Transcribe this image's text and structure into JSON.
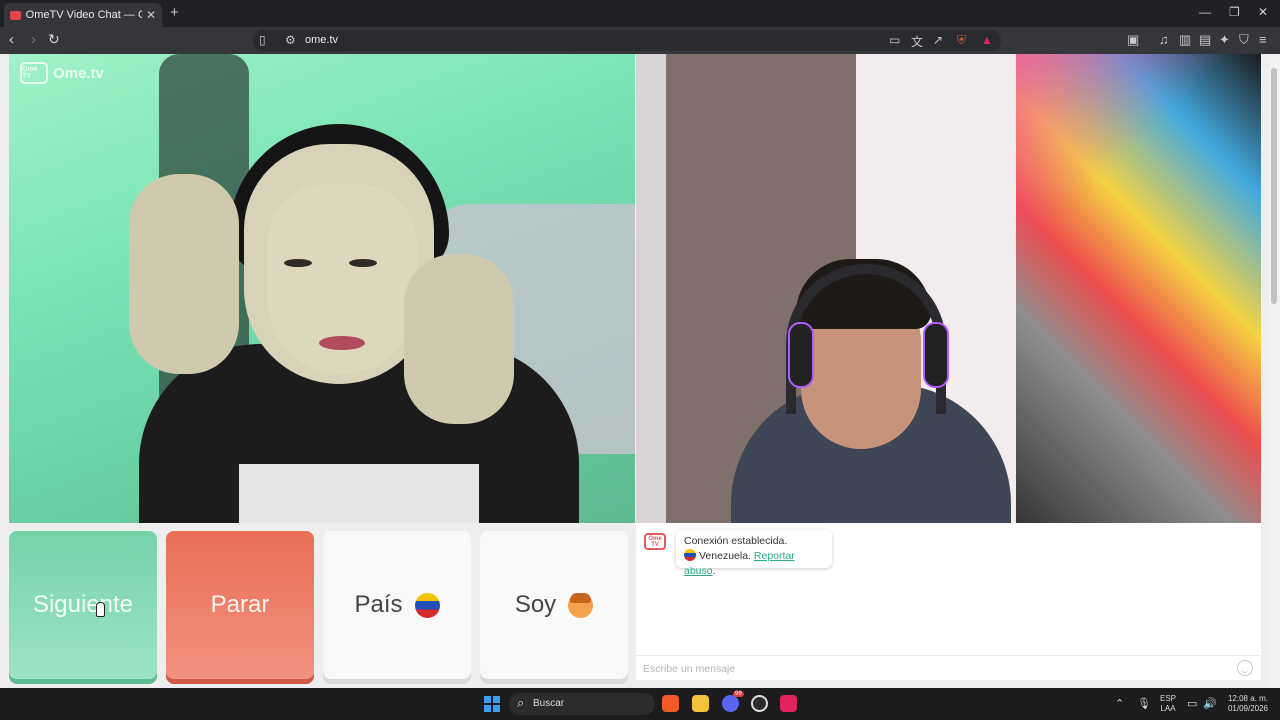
{
  "browser": {
    "tab_title": "OmeTV Video Chat — Omegle",
    "url": "ome.tv"
  },
  "site": {
    "logo_small": "Ome TV",
    "logo_text": "Ome.tv"
  },
  "controls": {
    "next": "Siguiente",
    "stop": "Parar",
    "country": "País",
    "soy": "Soy"
  },
  "chat": {
    "logo": "Ome TV",
    "status": "Conexión establecida.",
    "country": "Venezuela.",
    "report": "Reportar abuso",
    "report_suffix": ".",
    "placeholder": "Escribe un mensaje"
  },
  "taskbar": {
    "search": "Buscar",
    "lang_top": "ESP",
    "lang_bottom": "LAA",
    "time": "12:08 a. m.",
    "date": "01/09/2026",
    "discord_badge": "99"
  },
  "colors": {
    "next": "#7dd6ad",
    "stop": "#ec7a61",
    "accent_link": "#2bab7d"
  },
  "icons": [
    "youtube-favicon-icon",
    "back-icon",
    "forward-icon",
    "reload-icon",
    "bookmark-icon",
    "site-settings-icon",
    "cast-icon",
    "translate-icon",
    "share-icon",
    "brave-shield-icon",
    "brave-rewards-icon",
    "reader-icon",
    "music-icon",
    "sidebar-icon",
    "wallet-icon",
    "leo-icon",
    "vpn-icon",
    "menu-icon",
    "venezuela-flag-icon",
    "boy-avatar-icon",
    "emoji-icon",
    "windows-start-icon"
  ]
}
